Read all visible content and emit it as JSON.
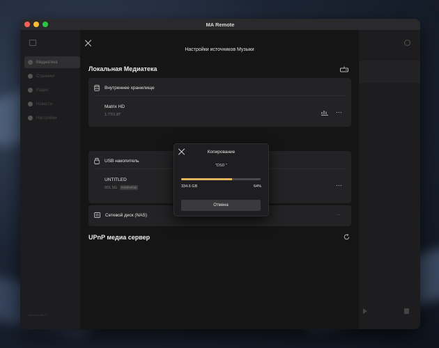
{
  "window": {
    "title": "MA Remote"
  },
  "sidebar": {
    "items": [
      {
        "label": "Медиатека",
        "active": true
      },
      {
        "label": "Стриминг"
      },
      {
        "label": "Радио"
      },
      {
        "label": "Новости"
      },
      {
        "label": "Настройки"
      }
    ],
    "footer": "Matrix Audio ??"
  },
  "panel": {
    "title": "Настройки источников Музыки",
    "local_section": "Локальная Медиатека",
    "internal_storage": {
      "header": "Внутреннее хранилище",
      "drive_name": "Matrix HD",
      "capacity": "1.7T/1.8T"
    },
    "usb": {
      "header": "USB накопитель",
      "drive_name": "UNTITLED",
      "capacity": "931.5G",
      "filesystem": "FAT/FAT32"
    },
    "nas": {
      "header": "Сетевой диск (NAS)",
      "status": "..."
    },
    "upnp_section": "UPnP медиа сервер",
    "more_label": "..."
  },
  "dialog": {
    "title": "Копирование",
    "file": "\"DSD \"",
    "progress": 0.64,
    "size": "334.6 GB",
    "percent": "64%",
    "cancel_label": "Отмена"
  },
  "colors": {
    "accent": "#e2b25c",
    "window_bg": "#1b1b1d",
    "panel_bg": "#151516",
    "card_bg": "#232325"
  }
}
